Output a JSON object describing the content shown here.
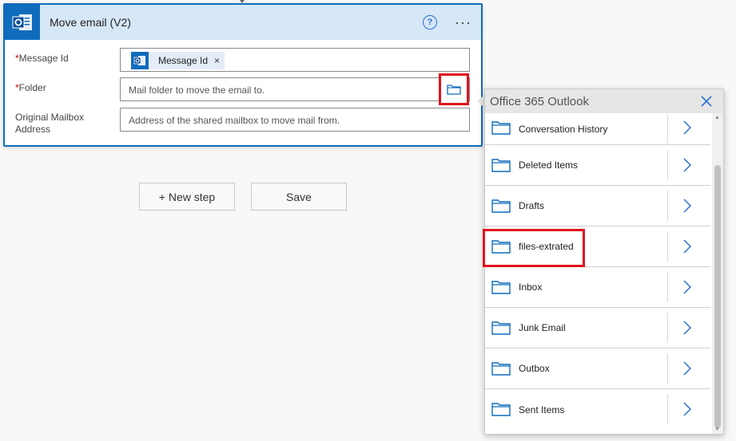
{
  "card": {
    "title": "Move email (V2)",
    "help_glyph": "?",
    "more_glyph": "···"
  },
  "fields": {
    "message_id": {
      "label": "Message Id",
      "required_mark": "*",
      "token_label": "Message Id",
      "token_close": "×"
    },
    "folder": {
      "label": "Folder",
      "required_mark": "*",
      "placeholder": "Mail folder to move the email to."
    },
    "mailbox": {
      "label_line1": "Original Mailbox",
      "label_line2": "Address",
      "placeholder": "Address of the shared mailbox to move mail from."
    }
  },
  "buttons": {
    "new_step": "+ New step",
    "save": "Save"
  },
  "picker": {
    "title": "Office 365 Outlook",
    "items": [
      "Conversation History",
      "Deleted Items",
      "Drafts",
      "files-extrated",
      "Inbox",
      "Junk Email",
      "Outbox",
      "Sent Items"
    ]
  },
  "colors": {
    "accent": "#0f6cbd",
    "highlight": "#e0121f",
    "header_bg": "#d6e7f7"
  },
  "icons": {
    "app": "outlook-icon",
    "help": "help-icon",
    "more": "more-options-icon",
    "folder": "folder-icon",
    "close": "close-icon",
    "chevron": "chevron-right-icon"
  }
}
